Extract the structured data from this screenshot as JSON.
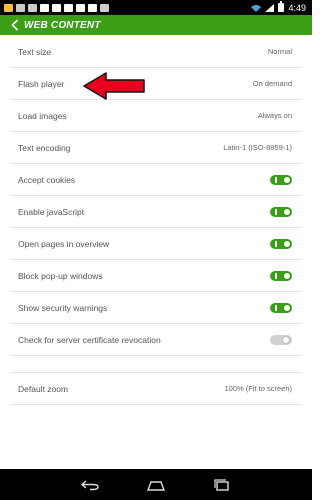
{
  "status_bar": {
    "time": "4:49"
  },
  "header": {
    "title": "WEB CONTENT"
  },
  "settings": [
    {
      "label": "Text size",
      "value": "Normal"
    },
    {
      "label": "Flash player",
      "value": "On demand"
    },
    {
      "label": "Load images",
      "value": "Always on"
    },
    {
      "label": "Text encoding",
      "value": "Latin-1 (ISO-8859-1)"
    },
    {
      "label": "Accept cookies",
      "toggle": true
    },
    {
      "label": "Enable javaScript",
      "toggle": true
    },
    {
      "label": "Open pages in overview",
      "toggle": true
    },
    {
      "label": "Block pop-up windows",
      "toggle": true
    },
    {
      "label": "Show security warnings",
      "toggle": true
    },
    {
      "label": "Check for server certificate revocation",
      "toggle": false
    },
    {
      "label": "Default zoom",
      "value": "100% (Fit to screen)"
    }
  ],
  "colors": {
    "accent": "#3c9e17",
    "arrow": "#e8001c"
  },
  "icons": [
    "chevron-left-icon",
    "red-arrow-annotation",
    "back-nav-icon",
    "home-nav-icon",
    "recents-nav-icon",
    "wifi-icon",
    "signal-icon",
    "battery-icon"
  ]
}
